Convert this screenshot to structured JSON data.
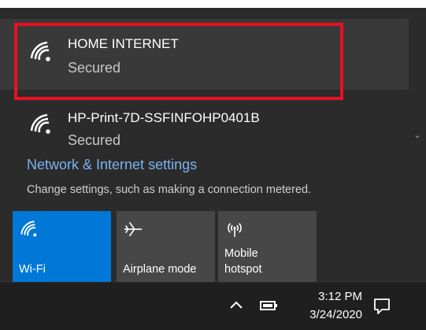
{
  "networks": [
    {
      "name": "HOME INTERNET",
      "status": "Secured",
      "icon": "wifi-icon"
    },
    {
      "name": "HP-Print-7D-SSFINFOHP0401B",
      "status": "Secured",
      "icon": "wifi-icon"
    }
  ],
  "settings": {
    "link": "Network & Internet settings",
    "description": "Change settings, such as making a connection metered."
  },
  "quick_actions": [
    {
      "label": "Wi-Fi",
      "icon": "wifi-icon",
      "active": true
    },
    {
      "label": "Airplane mode",
      "icon": "airplane-icon",
      "active": false
    },
    {
      "label_line1": "Mobile",
      "label_line2": "hotspot",
      "icon": "hotspot-icon",
      "active": false
    }
  ],
  "taskbar": {
    "time": "3:12 PM",
    "date": "3/24/2020",
    "icons": [
      "chevron-up-icon",
      "battery-icon",
      "notification-icon"
    ]
  },
  "colors": {
    "highlight_border": "#e81123",
    "accent": "#0078d7",
    "link": "#7ab3f0",
    "flyout_bg": "#2b2b2b",
    "tile_bg": "#474747"
  }
}
